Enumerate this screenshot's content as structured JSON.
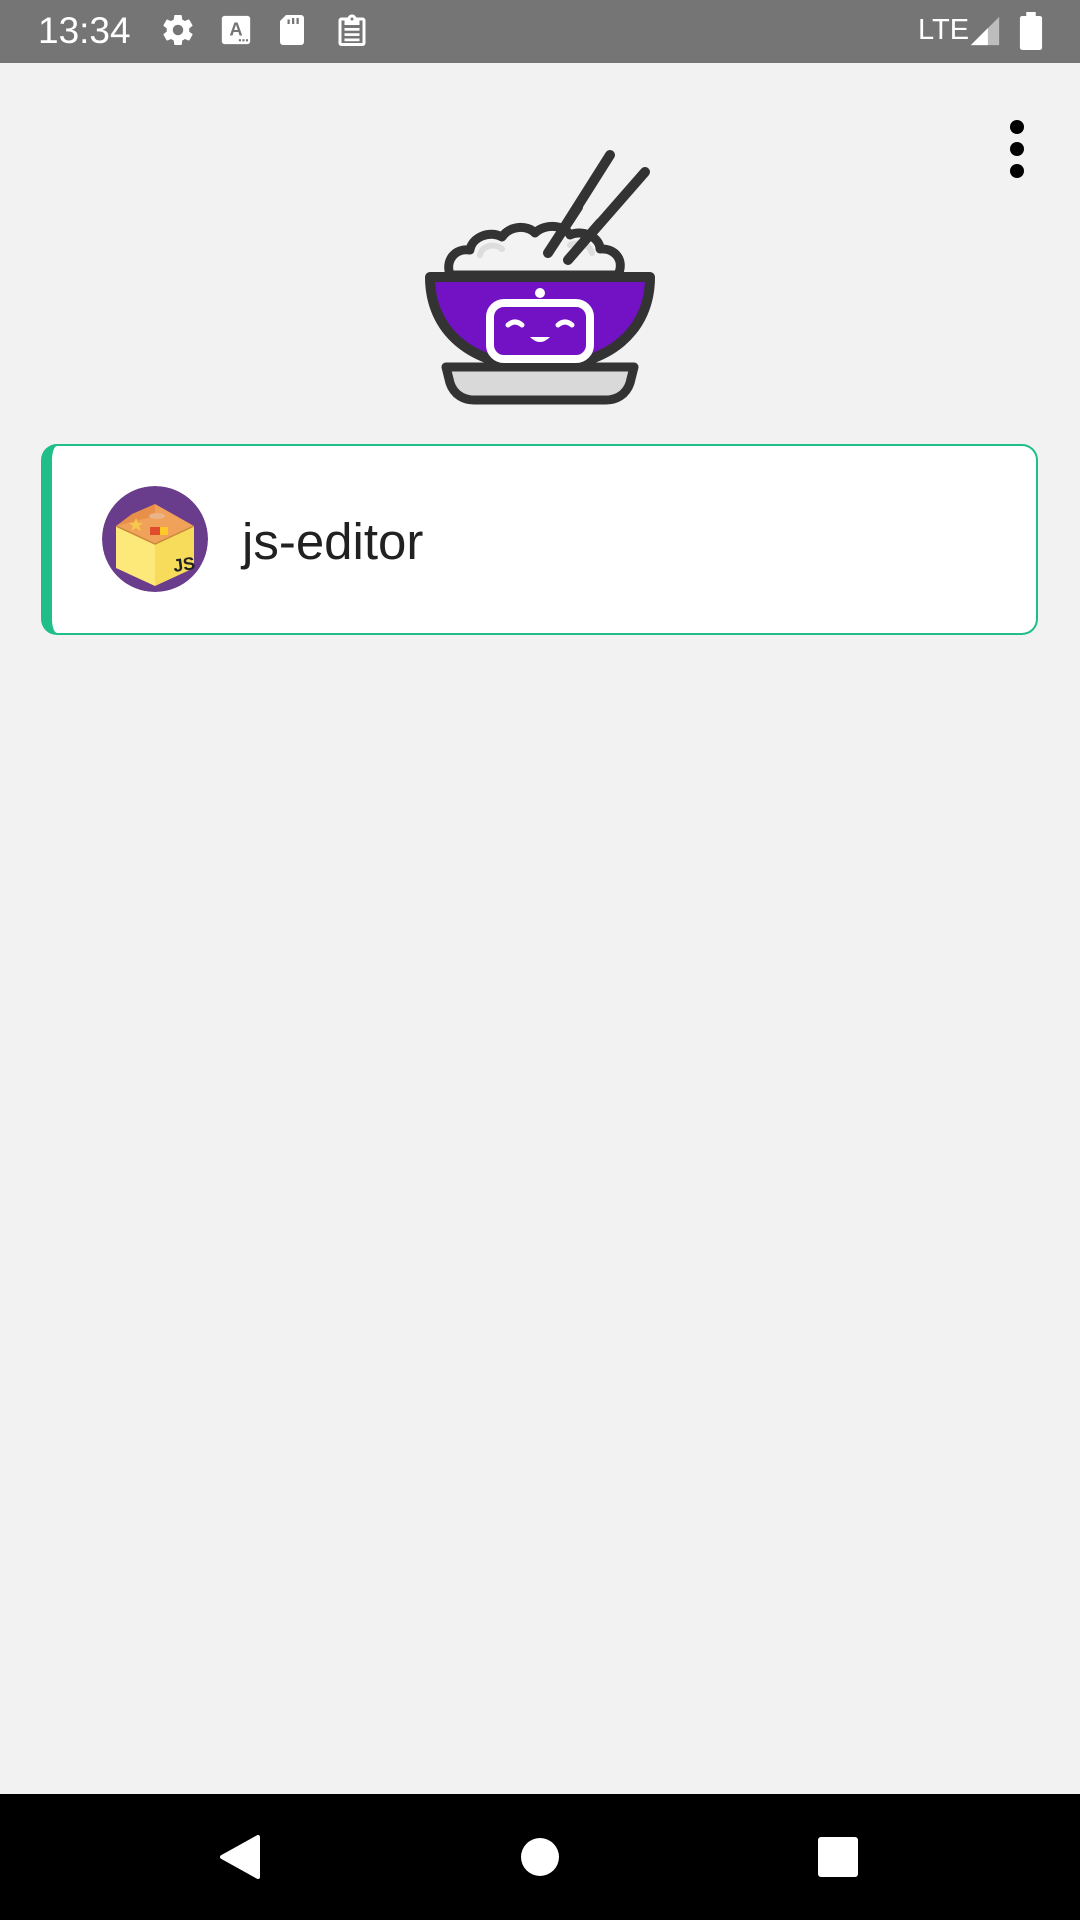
{
  "status_bar": {
    "time": "13:34",
    "network": "LTE",
    "icons": [
      "settings-icon",
      "keyboard-a-icon",
      "sd-card-icon",
      "clipboard-icon",
      "signal-icon",
      "battery-icon"
    ]
  },
  "app": {
    "logo": "rice-bowl-robot-logo",
    "menu_icon": "more-vert-icon"
  },
  "servers": [
    {
      "name": "js-editor",
      "avatar": "js-box-icon",
      "accent_color": "#1fbf87"
    }
  ],
  "nav_bar": {
    "buttons": [
      "back-icon",
      "home-icon",
      "recents-icon"
    ]
  },
  "colors": {
    "status_bar": "#757575",
    "background": "#f2f2f2",
    "accent": "#1fbf87",
    "bowl_purple": "#7212c4"
  }
}
